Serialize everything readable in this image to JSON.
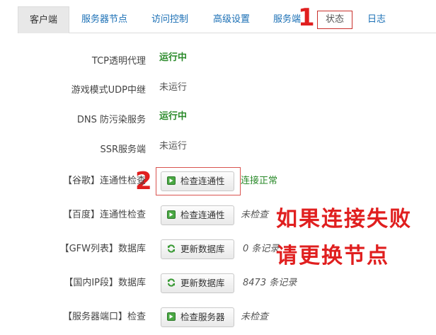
{
  "tabs": [
    {
      "label": "客户端",
      "active": true
    },
    {
      "label": "服务器节点"
    },
    {
      "label": "访问控制"
    },
    {
      "label": "高级设置"
    },
    {
      "label": "服务端"
    },
    {
      "label": "状态"
    },
    {
      "label": "日志"
    }
  ],
  "annotations": {
    "one": "1",
    "two": "2",
    "note_line1": "如果连接失败",
    "note_line2": "请更换节点"
  },
  "status_rows": [
    {
      "label": "TCP透明代理",
      "value": "运行中"
    },
    {
      "label": "游戏模式UDP中继",
      "value": "未运行"
    },
    {
      "label": "DNS 防污染服务",
      "value": "运行中"
    },
    {
      "label": "SSR服务端",
      "value": "未运行"
    }
  ],
  "action_rows": [
    {
      "label": "【谷歌】连通性检查",
      "button": "检查连通性",
      "result": "连接正常"
    },
    {
      "label": "【百度】连通性检查",
      "button": "检查连通性",
      "result": "未检查"
    },
    {
      "label": "【GFW列表】数据库",
      "button": "更新数据库",
      "result": "0 条记录"
    },
    {
      "label": "【国内IP段】数据库",
      "button": "更新数据库",
      "result": "8473 条记录"
    },
    {
      "label": "【服务器端口】检查",
      "button": "检查服务器",
      "result": "未检查"
    }
  ],
  "colors": {
    "link": "#1a6fb5",
    "running": "#2a8a2a",
    "annotation": "#e01f1f"
  },
  "icons": {
    "check": "check-square-icon",
    "refresh": "refresh-icon"
  }
}
